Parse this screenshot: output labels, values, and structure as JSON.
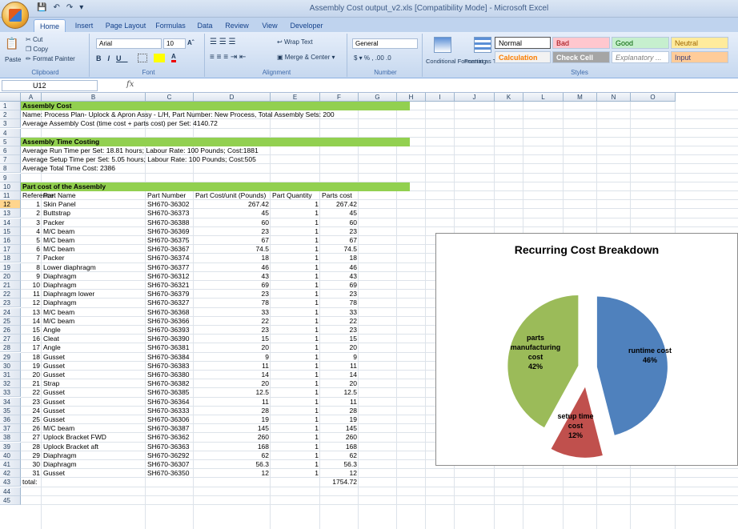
{
  "window": {
    "title": "Assembly Cost output_v2.xls [Compatibility Mode] - Microsoft Excel"
  },
  "tabs": [
    "Home",
    "Insert",
    "Page Layout",
    "Formulas",
    "Data",
    "Review",
    "View",
    "Developer"
  ],
  "ribbon": {
    "clipboard": {
      "paste": "Paste",
      "cut": "Cut",
      "copy": "Copy",
      "format_painter": "Format Painter",
      "name": "Clipboard"
    },
    "font": {
      "family": "Arial",
      "size": "10",
      "name": "Font"
    },
    "alignment": {
      "wrap": "Wrap Text",
      "merge": "Merge & Center",
      "name": "Alignment"
    },
    "number": {
      "format": "General",
      "name": "Number"
    },
    "cond_format": "Conditional Formatting",
    "format_table": "Format as Table",
    "styles": {
      "normal": "Normal",
      "bad": "Bad",
      "good": "Good",
      "neutral": "Neutral",
      "calculation": "Calculation",
      "check_cell": "Check Cell",
      "explanatory": "Explanatory ...",
      "input": "Input",
      "name": "Styles"
    }
  },
  "formula_bar": {
    "name_box": "U12",
    "fx": "fx",
    "value": ""
  },
  "columns": [
    "A",
    "B",
    "C",
    "D",
    "E",
    "F",
    "G",
    "H",
    "I",
    "J",
    "K",
    "L",
    "M",
    "N",
    "O"
  ],
  "sheet": {
    "r1": "Assembly Cost",
    "r2": "Name: Process Plan- Uplock & Apron Assy - L/H,   Part Number: New Process,   Total Assembly Sets: 200",
    "r3": "Average Assembly Cost (time cost + parts cost) per Set: 4140.72",
    "r5": "Assembly Time Costing",
    "r6": "Average Run Time per Set:  18.81 hours;  Labour Rate:  100 Pounds;   Cost:1881",
    "r7": "Average Setup Time per Set:  5.05 hours;  Labour Rate:  100 Pounds;   Cost:505",
    "r8": "Average Total Time Cost: 2386",
    "r10": "Part cost of the Assembly",
    "headers": [
      "Reference",
      "Part Name",
      "Part Number",
      "Part Cost/unit (Pounds)",
      "Part Quantity",
      "Parts cost"
    ],
    "parts": [
      [
        "1",
        "Skin Panel",
        "SH670-36302",
        "267.42",
        "1",
        "267.42"
      ],
      [
        "2",
        "Buttstrap",
        "SH670-36373",
        "45",
        "1",
        "45"
      ],
      [
        "3",
        "Packer",
        "SH670-36388",
        "60",
        "1",
        "60"
      ],
      [
        "4",
        "M/C beam",
        "SH670-36369",
        "23",
        "1",
        "23"
      ],
      [
        "5",
        "M/C beam",
        "SH670-36375",
        "67",
        "1",
        "67"
      ],
      [
        "6",
        "M/C beam",
        "SH670-36367",
        "74.5",
        "1",
        "74.5"
      ],
      [
        "7",
        "Packer",
        "SH670-36374",
        "18",
        "1",
        "18"
      ],
      [
        "8",
        "Lower diaphragm",
        "SH670-36377",
        "46",
        "1",
        "46"
      ],
      [
        "9",
        "Diaphragm",
        "SH670-36312",
        "43",
        "1",
        "43"
      ],
      [
        "10",
        "Diaphragm",
        "SH670-36321",
        "69",
        "1",
        "69"
      ],
      [
        "11",
        "Diaphragm lower",
        "SH670-36379",
        "23",
        "1",
        "23"
      ],
      [
        "12",
        "Diaphragm",
        "SH670-36327",
        "78",
        "1",
        "78"
      ],
      [
        "13",
        "M/C beam",
        "SH670-36368",
        "33",
        "1",
        "33"
      ],
      [
        "14",
        "M/C beam",
        "SH670-36366",
        "22",
        "1",
        "22"
      ],
      [
        "15",
        "Angle",
        "SH670-36393",
        "23",
        "1",
        "23"
      ],
      [
        "16",
        "Cleat",
        "SH670-36390",
        "15",
        "1",
        "15"
      ],
      [
        "17",
        "Angle",
        "SH670-36381",
        "20",
        "1",
        "20"
      ],
      [
        "18",
        "Gusset",
        "SH670-36384",
        "9",
        "1",
        "9"
      ],
      [
        "19",
        "Gusset",
        "SH670-36383",
        "11",
        "1",
        "11"
      ],
      [
        "20",
        "Gusset",
        "SH670-36380",
        "14",
        "1",
        "14"
      ],
      [
        "21",
        "Strap",
        "SH670-36382",
        "20",
        "1",
        "20"
      ],
      [
        "22",
        "Gusset",
        "SH670-36385",
        "12.5",
        "1",
        "12.5"
      ],
      [
        "23",
        "Gusset",
        "SH670-36364",
        "11",
        "1",
        "11"
      ],
      [
        "24",
        "Gusset",
        "SH670-36333",
        "28",
        "1",
        "28"
      ],
      [
        "25",
        "Gusset",
        "SH670-36306",
        "19",
        "1",
        "19"
      ],
      [
        "26",
        "M/C beam",
        "SH670-36387",
        "145",
        "1",
        "145"
      ],
      [
        "27",
        "Uplock Bracket FWD",
        "SH670-36362",
        "260",
        "1",
        "260"
      ],
      [
        "28",
        "Uplock Bracket aft",
        "SH670-36363",
        "168",
        "1",
        "168"
      ],
      [
        "29",
        "Diaphragm",
        "SH670-36292",
        "62",
        "1",
        "62"
      ],
      [
        "30",
        "Diaphragm",
        "SH670-36307",
        "56.3",
        "1",
        "56.3"
      ],
      [
        "31",
        "Gusset",
        "SH670-36350",
        "12",
        "1",
        "12"
      ]
    ],
    "total_label": "total:",
    "total_value": "1754.72"
  },
  "chart_data": {
    "type": "pie",
    "title": "Recurring Cost Breakdown",
    "slices": [
      {
        "label": "runtime cost",
        "value": 46,
        "pct": "46%",
        "color": "#4f81bd"
      },
      {
        "label": "setup time cost",
        "value": 12,
        "pct": "12%",
        "color": "#c0504d"
      },
      {
        "label": "parts manufacturing cost",
        "value": 42,
        "pct": "42%",
        "color": "#9bbb59"
      }
    ]
  }
}
